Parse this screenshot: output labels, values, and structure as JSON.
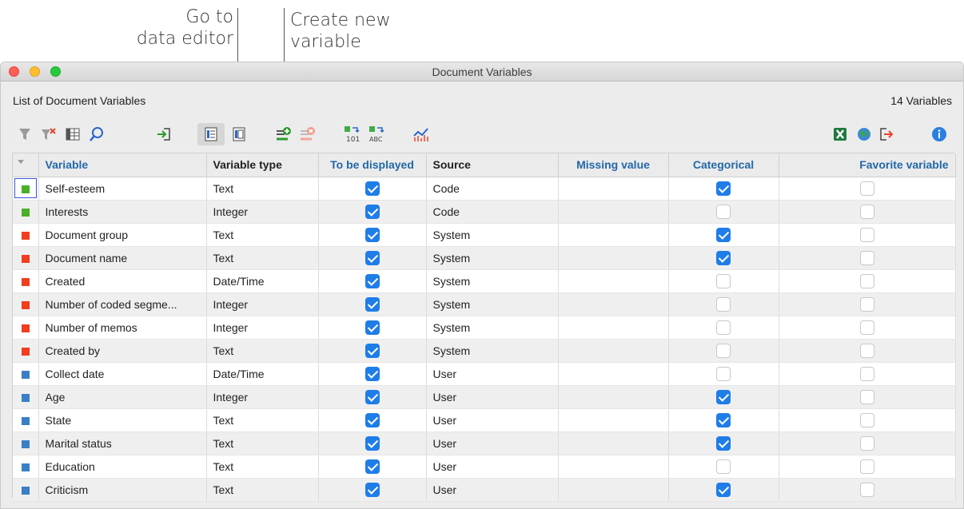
{
  "callouts": {
    "data_editor": [
      "Go to",
      "data editor"
    ],
    "new_variable": [
      "Create new",
      "variable"
    ]
  },
  "window": {
    "title": "Document Variables",
    "list_heading": "List of Document Variables",
    "variable_count": "14 Variables"
  },
  "colors": {
    "code": "#4caf2a",
    "system": "#f23d1f",
    "user": "#3a7fc4",
    "check_on": "#1f7de8",
    "header_blue": "#2268a8"
  },
  "toolbar": {
    "icons": [
      "filter-icon",
      "clear-filter-icon",
      "columns-icon",
      "search-icon",
      "import-icon",
      "list-view-icon",
      "data-editor-icon",
      "new-variable-icon",
      "delete-variable-icon",
      "convert-to-integer-icon",
      "convert-to-text-icon",
      "statistics-icon",
      "excel-export-icon",
      "html-export-icon",
      "export-icon",
      "info-icon"
    ]
  },
  "table": {
    "columns": [
      "",
      "Variable",
      "Variable type",
      "To be displayed",
      "Source",
      "Missing value",
      "Categorical",
      "Favorite variable"
    ],
    "rows": [
      {
        "source_kind": "code",
        "variable": "Self-esteem",
        "type": "Text",
        "displayed": true,
        "source": "Code",
        "missing": "",
        "categorical": true,
        "favorite": false
      },
      {
        "source_kind": "code",
        "variable": "Interests",
        "type": "Integer",
        "displayed": true,
        "source": "Code",
        "missing": "",
        "categorical": false,
        "favorite": false
      },
      {
        "source_kind": "system",
        "variable": "Document group",
        "type": "Text",
        "displayed": true,
        "source": "System",
        "missing": "",
        "categorical": true,
        "favorite": false
      },
      {
        "source_kind": "system",
        "variable": "Document name",
        "type": "Text",
        "displayed": true,
        "source": "System",
        "missing": "",
        "categorical": true,
        "favorite": false
      },
      {
        "source_kind": "system",
        "variable": "Created",
        "type": "Date/Time",
        "displayed": true,
        "source": "System",
        "missing": "",
        "categorical": false,
        "favorite": false
      },
      {
        "source_kind": "system",
        "variable": "Number of coded segme...",
        "type": "Integer",
        "displayed": true,
        "source": "System",
        "missing": "",
        "categorical": false,
        "favorite": false
      },
      {
        "source_kind": "system",
        "variable": "Number of memos",
        "type": "Integer",
        "displayed": true,
        "source": "System",
        "missing": "",
        "categorical": false,
        "favorite": false
      },
      {
        "source_kind": "system",
        "variable": "Created by",
        "type": "Text",
        "displayed": true,
        "source": "System",
        "missing": "",
        "categorical": false,
        "favorite": false
      },
      {
        "source_kind": "user",
        "variable": "Collect date",
        "type": "Date/Time",
        "displayed": true,
        "source": "User",
        "missing": "",
        "categorical": false,
        "favorite": false
      },
      {
        "source_kind": "user",
        "variable": "Age",
        "type": "Integer",
        "displayed": true,
        "source": "User",
        "missing": "",
        "categorical": true,
        "favorite": false
      },
      {
        "source_kind": "user",
        "variable": "State",
        "type": "Text",
        "displayed": true,
        "source": "User",
        "missing": "",
        "categorical": true,
        "favorite": false
      },
      {
        "source_kind": "user",
        "variable": "Marital status",
        "type": "Text",
        "displayed": true,
        "source": "User",
        "missing": "",
        "categorical": true,
        "favorite": false
      },
      {
        "source_kind": "user",
        "variable": "Education",
        "type": "Text",
        "displayed": true,
        "source": "User",
        "missing": "",
        "categorical": false,
        "favorite": false
      },
      {
        "source_kind": "user",
        "variable": "Criticism",
        "type": "Text",
        "displayed": true,
        "source": "User",
        "missing": "",
        "categorical": true,
        "favorite": false
      }
    ]
  }
}
